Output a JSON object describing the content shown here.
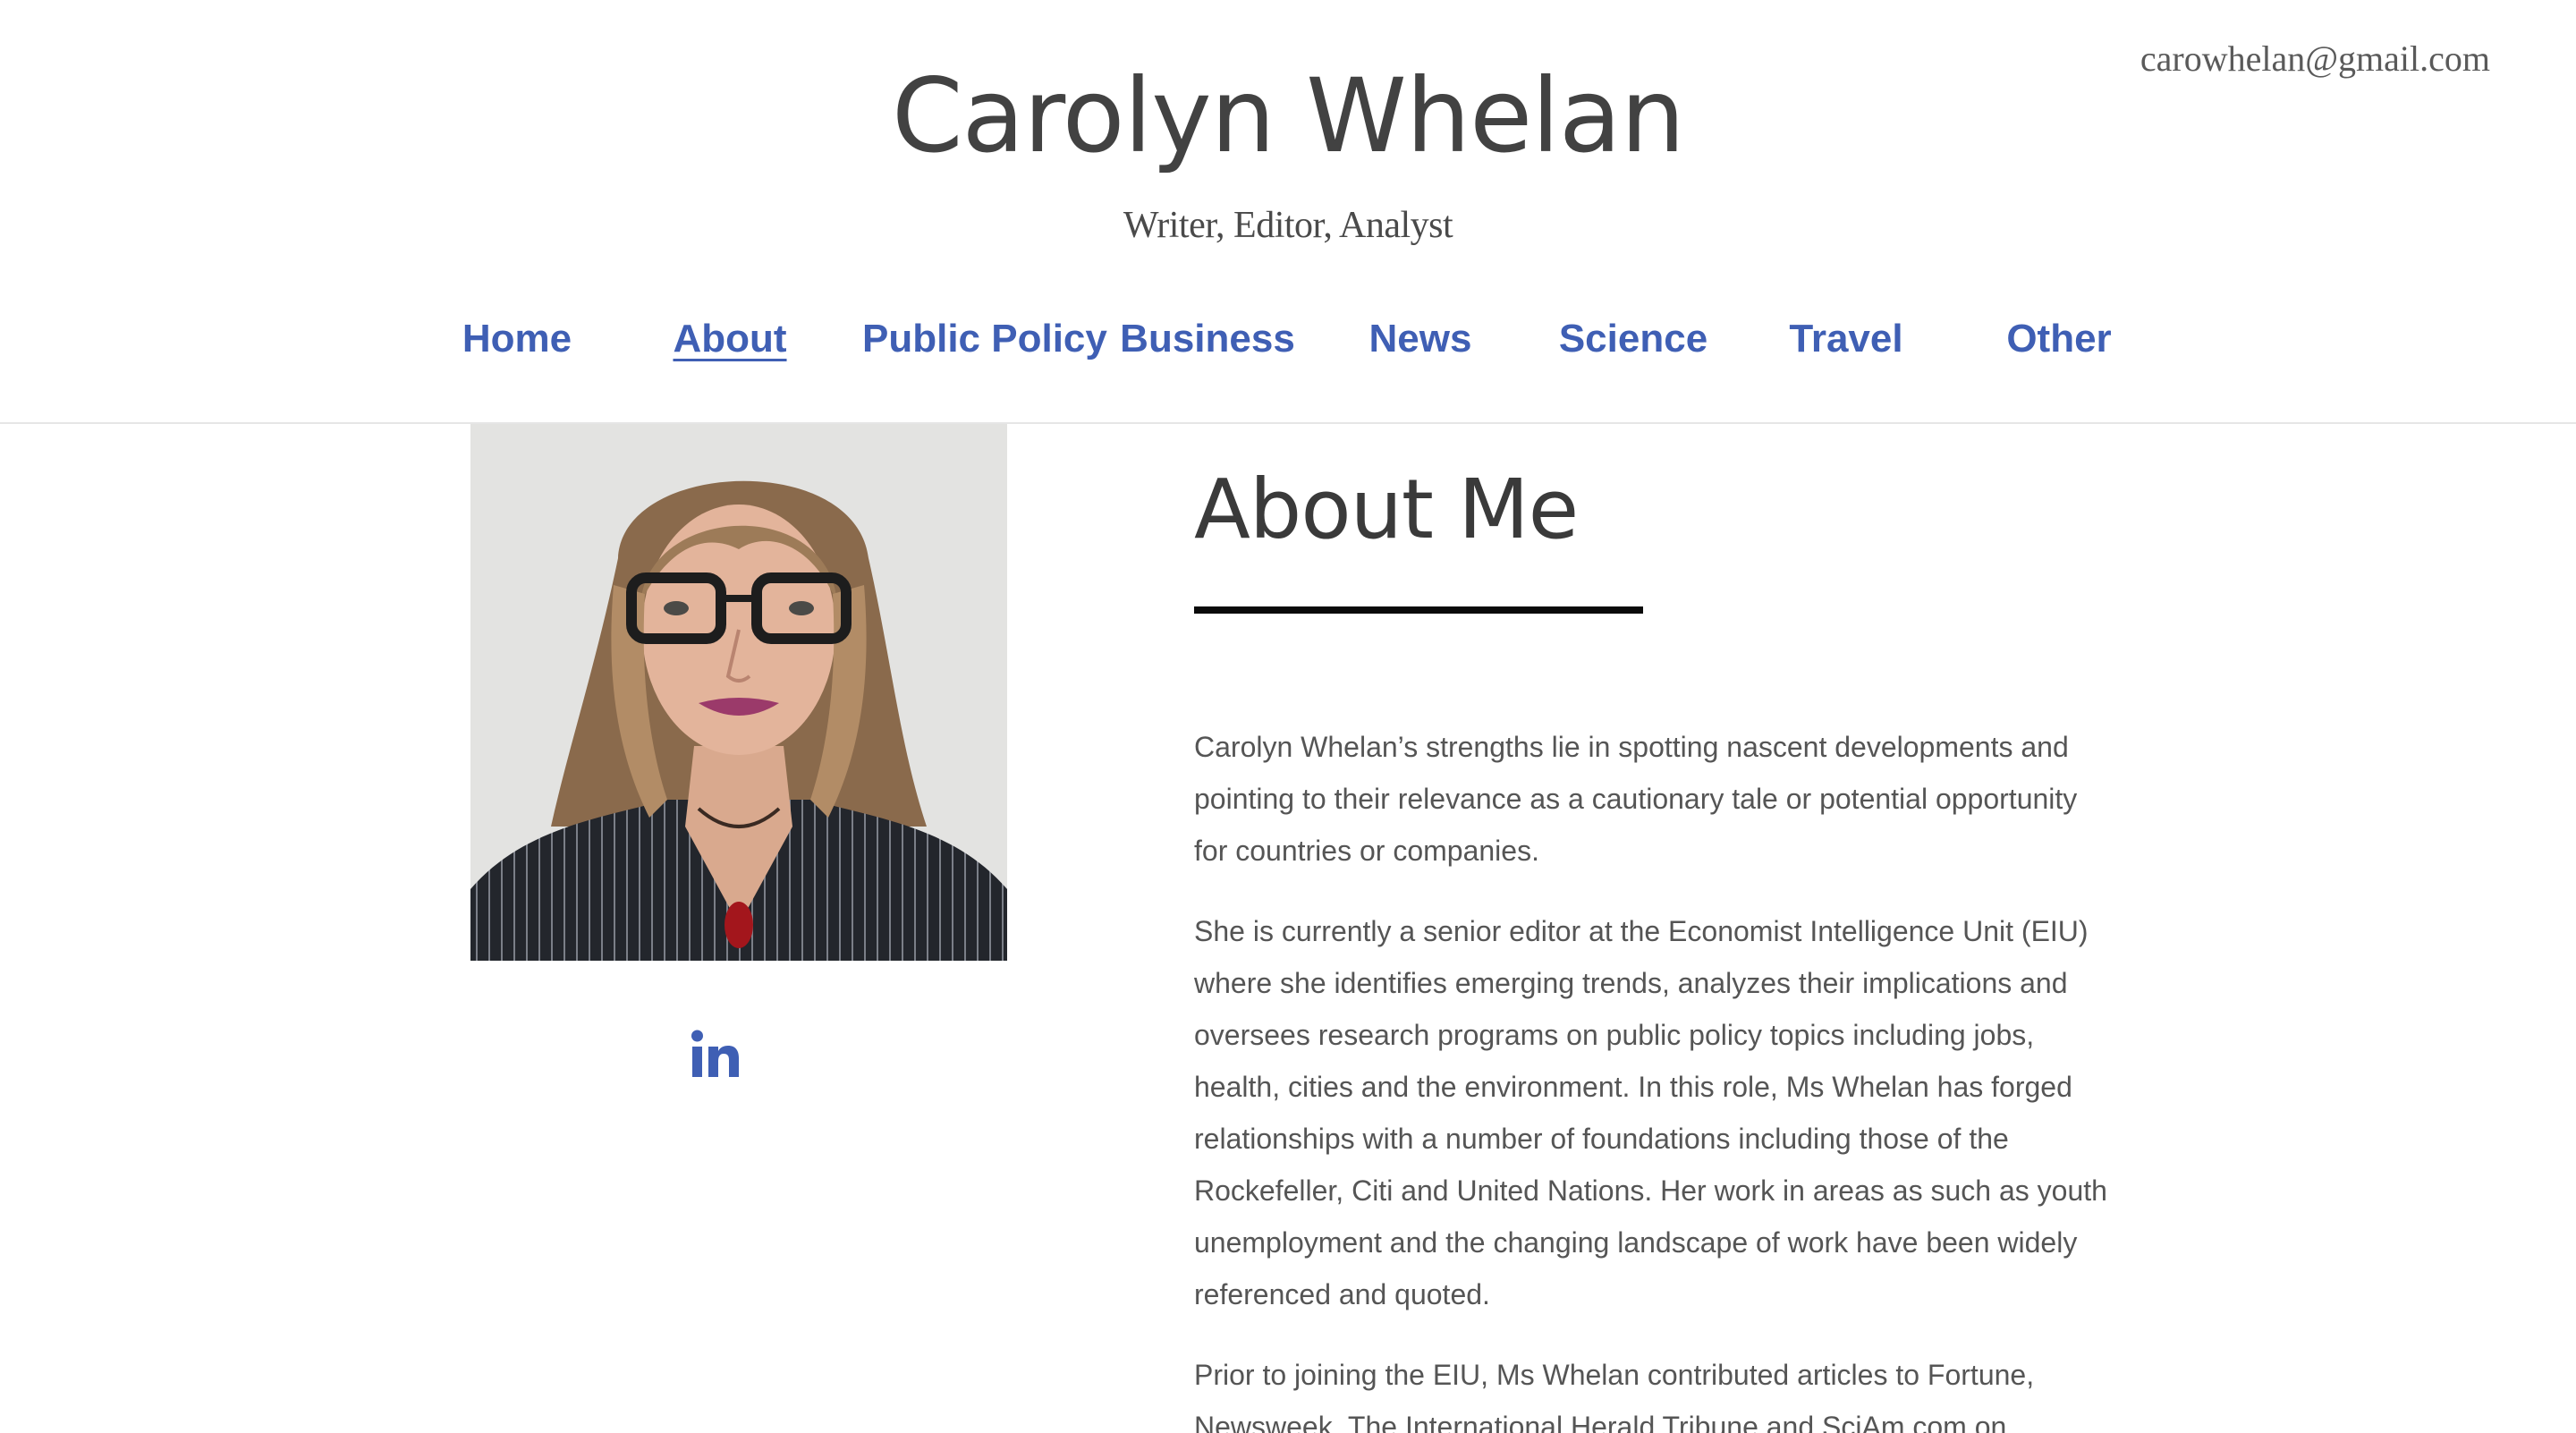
{
  "header": {
    "email": "carowhelan@gmail.com",
    "title": "Carolyn Whelan",
    "tagline": "Writer, Editor, Analyst"
  },
  "nav": {
    "items": [
      {
        "label": "Home",
        "active": false
      },
      {
        "label": "About",
        "active": true
      },
      {
        "label": "Public Policy",
        "active": false
      },
      {
        "label": "Business",
        "active": false
      },
      {
        "label": "News",
        "active": false
      },
      {
        "label": "Science",
        "active": false
      },
      {
        "label": "Travel",
        "active": false
      },
      {
        "label": "Other",
        "active": false
      }
    ]
  },
  "sidebar": {
    "social_icon": "linkedin-icon"
  },
  "about": {
    "heading": "About Me",
    "paragraphs": [
      "Carolyn Whelan’s strengths lie in spotting nascent developments and pointing to their relevance as a cautionary tale or potential opportunity for countries or companies.",
      "She is currently a senior editor at the Economist Intelligence Unit (EIU) where she identifies emerging trends, analyzes their implications and oversees research programs on public policy topics including jobs, health, cities and the environment. In this role, Ms Whelan has forged relationships with a number of foundations including those of the Rockefeller, Citi and United Nations. Her work in areas as such as youth unemployment and the changing landscape of work have been widely referenced and quoted.",
      "Prior to joining the EIU, Ms Whelan contributed articles to Fortune, Newsweek, The International Herald Tribune and SciAm.com on"
    ]
  },
  "colors": {
    "nav_link": "#3f5fb4",
    "title_text": "#424242",
    "body_text": "#555555",
    "rule": "#0a0a0a"
  }
}
